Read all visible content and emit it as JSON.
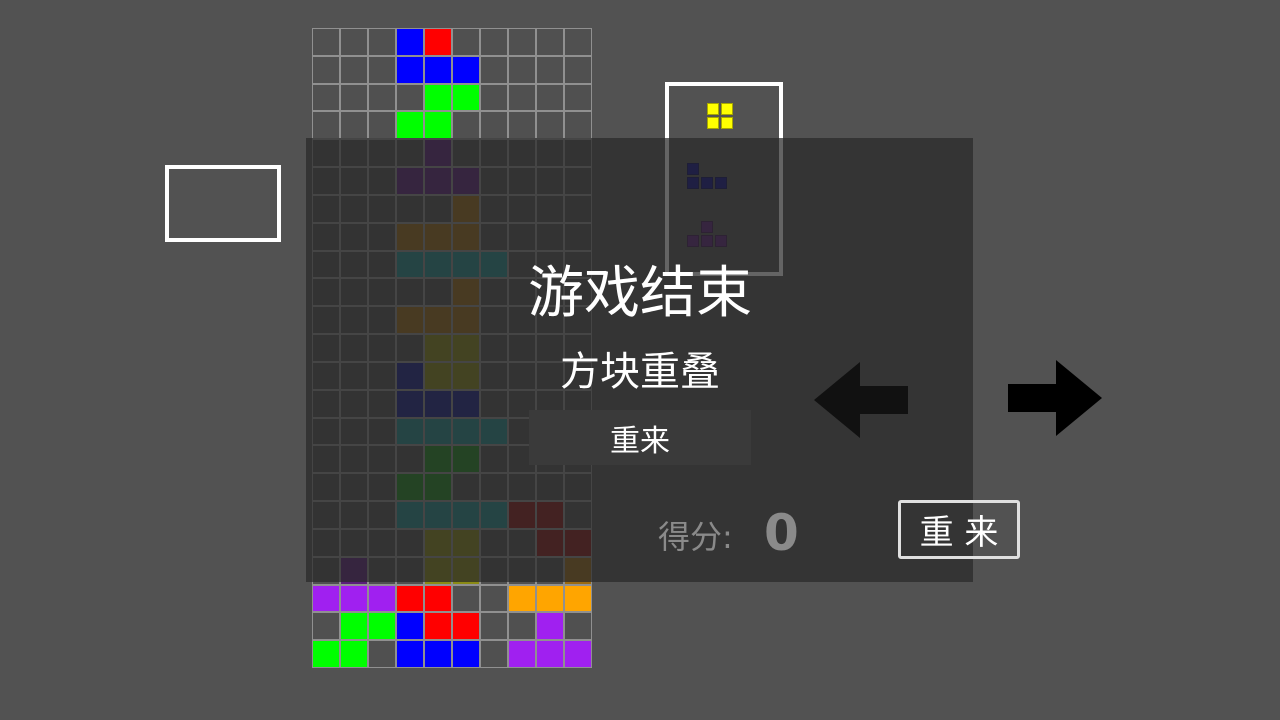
{
  "colors": {
    "background": "#525252",
    "red": "#ff0000",
    "blue": "#0000ff",
    "green": "#00ff00",
    "purple": "#a020f0",
    "orange": "#ffa500",
    "yellow": "#ffff00",
    "cyan": "#00cccc",
    "dim_purple": "#5a1f7a",
    "dim_orange": "#9a6a12",
    "dim_cyan": "#1e8c8c",
    "dim_olive": "#8a8a14",
    "dim_navy": "#141a8a",
    "dim_green": "#1a8a1a",
    "dim_red": "#8a1212",
    "navy_preview": "#0a0a8a"
  },
  "board_rows": [
    "...BR.....",
    "...BBB....",
    "....GG....",
    "...GG.....",
    "....P.....",
    "...PPP....",
    ".....O....",
    "...OOO....",
    "...CCCC...",
    ".....O....",
    "...OOO....",
    "....YY....",
    "...BYY....",
    "...BBB....",
    "...CCCC...",
    "....GG....",
    "...GG.....",
    "...CCCCRR.",
    "....YY..RR",
    ".P..YY...O",
    "PPPRR..OOO",
    ".GGBRR..P.",
    "GG.BBB.PPP"
  ],
  "hold": {
    "label": "",
    "icon": "hold-slot"
  },
  "next_pieces": [
    {
      "name": "O",
      "color": "#ffff00",
      "cells": [
        [
          0,
          0
        ],
        [
          1,
          0
        ],
        [
          0,
          1
        ],
        [
          1,
          1
        ]
      ]
    },
    {
      "name": "J",
      "color": "#0a0a8a",
      "cells": [
        [
          0,
          0
        ],
        [
          0,
          1
        ],
        [
          1,
          1
        ],
        [
          2,
          1
        ]
      ]
    },
    {
      "name": "T",
      "color": "#5a1f7a",
      "cells": [
        [
          1,
          0
        ],
        [
          0,
          1
        ],
        [
          1,
          1
        ],
        [
          2,
          1
        ]
      ]
    }
  ],
  "game_over": {
    "title": "游戏结束",
    "reason": "方块重叠",
    "restart_label": "重来"
  },
  "score": {
    "label": "得分:",
    "value": "0"
  },
  "controls": {
    "restart_label": "重 来",
    "left_icon": "arrow-left-icon",
    "right_icon": "arrow-right-icon"
  }
}
